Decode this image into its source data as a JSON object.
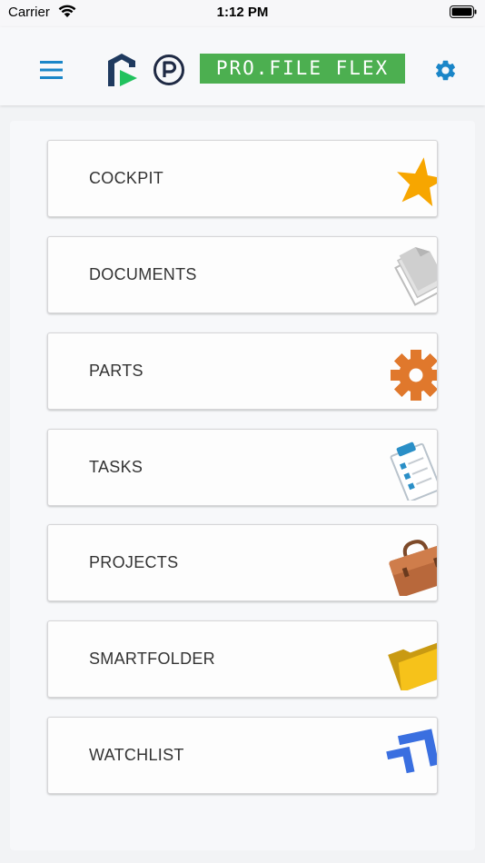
{
  "status_bar": {
    "carrier": "Carrier",
    "time": "1:12 PM",
    "icons": [
      "wifi-icon",
      "battery-icon"
    ]
  },
  "header": {
    "title": "PRO.FILE FLEX",
    "icons": [
      "menu-icon",
      "logo-r-icon",
      "logo-p-icon",
      "gear-icon"
    ],
    "colors": {
      "brand": "#4caf50",
      "accent": "#1a86c8"
    }
  },
  "modules": [
    {
      "label": "COCKPIT",
      "icon": "star-icon",
      "color": "#f7a600"
    },
    {
      "label": "DOCUMENTS",
      "icon": "documents-icon",
      "color": "#cfcfcf"
    },
    {
      "label": "PARTS",
      "icon": "gear-icon",
      "color": "#e0782c"
    },
    {
      "label": "TASKS",
      "icon": "clipboard-icon",
      "color": "#2a8fc7"
    },
    {
      "label": "PROJECTS",
      "icon": "briefcase-icon",
      "color": "#b8683b"
    },
    {
      "label": "SMARTFOLDER",
      "icon": "folder-icon",
      "color": "#f6c21a"
    },
    {
      "label": "WATCHLIST",
      "icon": "chevrons-icon",
      "color": "#3a6fe0"
    }
  ]
}
